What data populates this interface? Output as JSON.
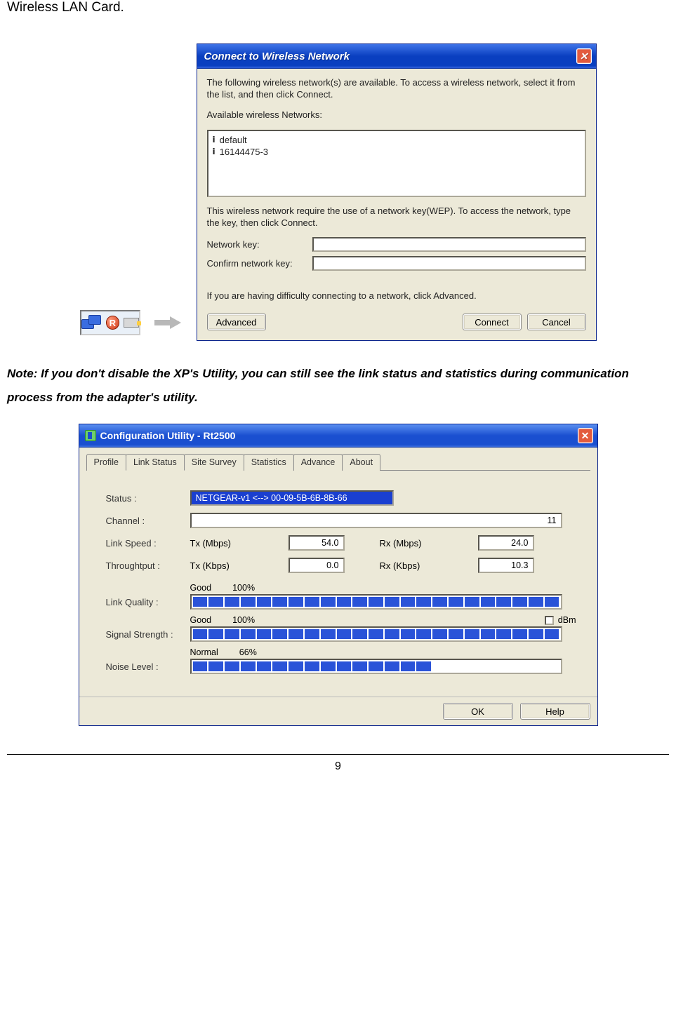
{
  "page": {
    "top_text": "Wireless LAN Card.",
    "note": "Note: If you don't disable the XP's Utility, you can still see the link status and statistics during communication process from the adapter's utility.",
    "page_number": "9"
  },
  "dialog1": {
    "title": "Connect to Wireless Network",
    "intro": "The following wireless network(s) are available. To access a wireless network, select it from the list, and then click Connect.",
    "list_label": "Available wireless Networks:",
    "networks": [
      "default",
      "16144475-3"
    ],
    "wep_text": "This wireless network require the use of a network key(WEP). To access the network, type the key, then click Connect.",
    "key_label": "Network key:",
    "confirm_label": "Confirm network key:",
    "adv_text": "If you are having difficulty connecting to a network, click Advanced.",
    "btn_advanced": "Advanced",
    "btn_connect": "Connect",
    "btn_cancel": "Cancel"
  },
  "dialog2": {
    "title": "Configuration Utility - Rt2500",
    "tabs": [
      "Profile",
      "Link Status",
      "Site Survey",
      "Statistics",
      "Advance",
      "About"
    ],
    "active_tab": 1,
    "status_label": "Status :",
    "status_value": "NETGEAR-v1 <--> 00-09-5B-6B-8B-66",
    "channel_label": "Channel :",
    "channel_value": "11",
    "linkspeed_label": "Link Speed :",
    "tx_mbps_label": "Tx (Mbps)",
    "tx_mbps_value": "54.0",
    "rx_mbps_label": "Rx (Mbps)",
    "rx_mbps_value": "24.0",
    "throughput_label": "Throughtput :",
    "tx_kbps_label": "Tx (Kbps)",
    "tx_kbps_value": "0.0",
    "rx_kbps_label": "Rx (Kbps)",
    "rx_kbps_value": "10.3",
    "lq_label": "Link Quality :",
    "lq_quality": "Good",
    "lq_pct": "100%",
    "ss_label": "Signal Strength :",
    "ss_quality": "Good",
    "ss_pct": "100%",
    "dbm_label": "dBm",
    "nl_label": "Noise Level :",
    "nl_quality": "Normal",
    "nl_pct": "66%",
    "btn_ok": "OK",
    "btn_help": "Help"
  },
  "bars": {
    "lq_segments": 23,
    "lq_fill": 23,
    "ss_segments": 23,
    "ss_fill": 23,
    "nl_segments": 23,
    "nl_fill": 15
  }
}
